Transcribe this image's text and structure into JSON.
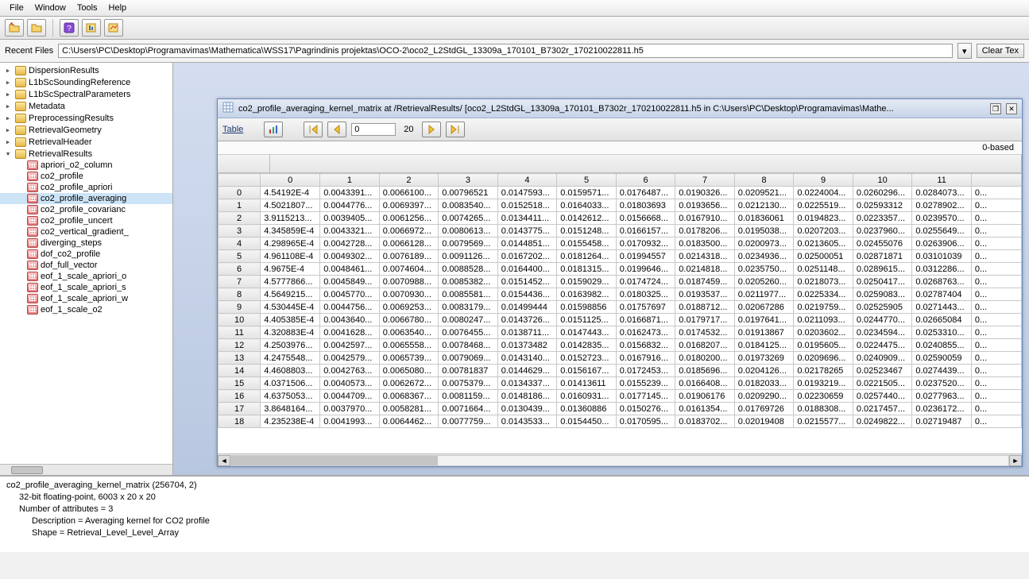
{
  "menu": {
    "items": [
      "File",
      "Window",
      "Tools",
      "Help"
    ]
  },
  "recent": {
    "label": "Recent Files",
    "path": "C:\\Users\\PC\\Desktop\\Programavimas\\Mathematica\\WSS17\\Pagrindinis projektas\\OCO-2\\oco2_L2StdGL_13309a_170101_B7302r_170210022811.h5",
    "clear": "Clear Tex"
  },
  "tree": {
    "groups": [
      "DispersionResults",
      "L1bScSoundingReference",
      "L1bScSpectralParameters",
      "Metadata",
      "PreprocessingResults",
      "RetrievalGeometry",
      "RetrievalHeader",
      "RetrievalResults"
    ],
    "datasets": [
      "apriori_o2_column",
      "co2_profile",
      "co2_profile_apriori",
      "co2_profile_averaging",
      "co2_profile_covarianc",
      "co2_profile_uncert",
      "co2_vertical_gradient_",
      "diverging_steps",
      "dof_co2_profile",
      "dof_full_vector",
      "eof_1_scale_apriori_o",
      "eof_1_scale_apriori_s",
      "eof_1_scale_apriori_w",
      "eof_1_scale_o2"
    ],
    "selected_index": 3
  },
  "innerwin": {
    "title": "co2_profile_averaging_kernel_matrix  at  /RetrievalResults/  [oco2_L2StdGL_13309a_170101_B7302r_170210022811.h5  in  C:\\Users\\PC\\Desktop\\Programavimas\\Mathe...",
    "table_link": "Table",
    "page_start": "0",
    "page_size": "20",
    "based": "0-based"
  },
  "table": {
    "cols": [
      "0",
      "1",
      "2",
      "3",
      "4",
      "5",
      "6",
      "7",
      "8",
      "9",
      "10",
      "11",
      ""
    ],
    "rows": [
      {
        "idx": "0",
        "c": [
          "4.54192E-4",
          "0.0043391...",
          "0.0066100...",
          "0.00796521",
          "0.0147593...",
          "0.0159571...",
          "0.0176487...",
          "0.0190326...",
          "0.0209521...",
          "0.0224004...",
          "0.0260296...",
          "0.0284073...",
          "0..."
        ]
      },
      {
        "idx": "1",
        "c": [
          "4.5021807...",
          "0.0044776...",
          "0.0069397...",
          "0.0083540...",
          "0.0152518...",
          "0.0164033...",
          "0.01803693",
          "0.0193656...",
          "0.0212130...",
          "0.0225519...",
          "0.02593312",
          "0.0278902...",
          "0..."
        ]
      },
      {
        "idx": "2",
        "c": [
          "3.9115213...",
          "0.0039405...",
          "0.0061256...",
          "0.0074265...",
          "0.0134411...",
          "0.0142612...",
          "0.0156668...",
          "0.0167910...",
          "0.01836061",
          "0.0194823...",
          "0.0223357...",
          "0.0239570...",
          "0..."
        ]
      },
      {
        "idx": "3",
        "c": [
          "4.345859E-4",
          "0.0043321...",
          "0.0066972...",
          "0.0080613...",
          "0.0143775...",
          "0.0151248...",
          "0.0166157...",
          "0.0178206...",
          "0.0195038...",
          "0.0207203...",
          "0.0237960...",
          "0.0255649...",
          "0..."
        ]
      },
      {
        "idx": "4",
        "c": [
          "4.298965E-4",
          "0.0042728...",
          "0.0066128...",
          "0.0079569...",
          "0.0144851...",
          "0.0155458...",
          "0.0170932...",
          "0.0183500...",
          "0.0200973...",
          "0.0213605...",
          "0.02455076",
          "0.0263906...",
          "0..."
        ]
      },
      {
        "idx": "5",
        "c": [
          "4.961108E-4",
          "0.0049302...",
          "0.0076189...",
          "0.0091126...",
          "0.0167202...",
          "0.0181264...",
          "0.01994557",
          "0.0214318...",
          "0.0234936...",
          "0.02500051",
          "0.02871871",
          "0.03101039",
          "0..."
        ]
      },
      {
        "idx": "6",
        "c": [
          "4.9675E-4",
          "0.0048461...",
          "0.0074604...",
          "0.0088528...",
          "0.0164400...",
          "0.0181315...",
          "0.0199646...",
          "0.0214818...",
          "0.0235750...",
          "0.0251148...",
          "0.0289615...",
          "0.0312286...",
          "0..."
        ]
      },
      {
        "idx": "7",
        "c": [
          "4.5777866...",
          "0.0045849...",
          "0.0070988...",
          "0.0085382...",
          "0.0151452...",
          "0.0159029...",
          "0.0174724...",
          "0.0187459...",
          "0.0205260...",
          "0.0218073...",
          "0.0250417...",
          "0.0268763...",
          "0..."
        ]
      },
      {
        "idx": "8",
        "c": [
          "4.5649215...",
          "0.0045770...",
          "0.0070930...",
          "0.0085581...",
          "0.0154436...",
          "0.0163982...",
          "0.0180325...",
          "0.0193537...",
          "0.0211977...",
          "0.0225334...",
          "0.0259083...",
          "0.02787404",
          "0..."
        ]
      },
      {
        "idx": "9",
        "c": [
          "4.530445E-4",
          "0.0044756...",
          "0.0069253...",
          "0.0083179...",
          "0.01499444",
          "0.01598856",
          "0.01757697",
          "0.0188712...",
          "0.02067286",
          "0.0219759...",
          "0.02525905",
          "0.0271443...",
          "0..."
        ]
      },
      {
        "idx": "10",
        "c": [
          "4.405385E-4",
          "0.0043640...",
          "0.0066780...",
          "0.0080247...",
          "0.0143726...",
          "0.0151125...",
          "0.0166871...",
          "0.0179717...",
          "0.0197641...",
          "0.0211093...",
          "0.0244770...",
          "0.02665084",
          "0..."
        ]
      },
      {
        "idx": "11",
        "c": [
          "4.320883E-4",
          "0.0041628...",
          "0.0063540...",
          "0.0076455...",
          "0.0138711...",
          "0.0147443...",
          "0.0162473...",
          "0.0174532...",
          "0.01913867",
          "0.0203602...",
          "0.0234594...",
          "0.0253310...",
          "0..."
        ]
      },
      {
        "idx": "12",
        "c": [
          "4.2503976...",
          "0.0042597...",
          "0.0065558...",
          "0.0078468...",
          "0.01373482",
          "0.0142835...",
          "0.0156832...",
          "0.0168207...",
          "0.0184125...",
          "0.0195605...",
          "0.0224475...",
          "0.0240855...",
          "0..."
        ]
      },
      {
        "idx": "13",
        "c": [
          "4.2475548...",
          "0.0042579...",
          "0.0065739...",
          "0.0079069...",
          "0.0143140...",
          "0.0152723...",
          "0.0167916...",
          "0.0180200...",
          "0.01973269",
          "0.0209696...",
          "0.0240909...",
          "0.02590059",
          "0..."
        ]
      },
      {
        "idx": "14",
        "c": [
          "4.4608803...",
          "0.0042763...",
          "0.0065080...",
          "0.00781837",
          "0.0144629...",
          "0.0156167...",
          "0.0172453...",
          "0.0185696...",
          "0.0204126...",
          "0.02178265",
          "0.02523467",
          "0.0274439...",
          "0..."
        ]
      },
      {
        "idx": "15",
        "c": [
          "4.0371506...",
          "0.0040573...",
          "0.0062672...",
          "0.0075379...",
          "0.0134337...",
          "0.01413611",
          "0.0155239...",
          "0.0166408...",
          "0.0182033...",
          "0.0193219...",
          "0.0221505...",
          "0.0237520...",
          "0..."
        ]
      },
      {
        "idx": "16",
        "c": [
          "4.6375053...",
          "0.0044709...",
          "0.0068367...",
          "0.0081159...",
          "0.0148186...",
          "0.0160931...",
          "0.0177145...",
          "0.01906176",
          "0.0209290...",
          "0.02230659",
          "0.0257440...",
          "0.0277963...",
          "0..."
        ]
      },
      {
        "idx": "17",
        "c": [
          "3.8648164...",
          "0.0037970...",
          "0.0058281...",
          "0.0071664...",
          "0.0130439...",
          "0.01360886",
          "0.0150276...",
          "0.0161354...",
          "0.01769726",
          "0.0188308...",
          "0.0217457...",
          "0.0236172...",
          "0..."
        ]
      },
      {
        "idx": "18",
        "c": [
          "4.235238E-4",
          "0.0041993...",
          "0.0064462...",
          "0.0077759...",
          "0.0143533...",
          "0.0154450...",
          "0.0170595...",
          "0.0183702...",
          "0.02019408",
          "0.0215577...",
          "0.0249822...",
          "0.02719487",
          "0..."
        ]
      }
    ]
  },
  "bottom": {
    "l1": "co2_profile_averaging_kernel_matrix (256704, 2)",
    "l2": "32-bit floating-point,    6003 x 20 x 20",
    "l3": "Number of attributes = 3",
    "l4": "Description = Averaging kernel for CO2 profile",
    "l5": "Shape = Retrieval_Level_Level_Array"
  }
}
